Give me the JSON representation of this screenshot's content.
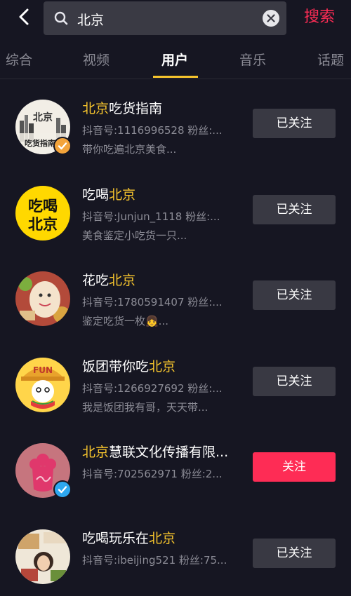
{
  "header": {
    "search_value": "北京",
    "search_button_label": "搜索"
  },
  "tabs": [
    {
      "label": "综合",
      "active": false
    },
    {
      "label": "视频",
      "active": false
    },
    {
      "label": "用户",
      "active": true
    },
    {
      "label": "音乐",
      "active": false
    },
    {
      "label": "话题",
      "active": false
    }
  ],
  "colors": {
    "accent": "#f6c42d",
    "brand_red": "#fe2c55",
    "background": "#161622"
  },
  "users": [
    {
      "name_highlight": "北京",
      "name_rest": "吃货指南",
      "name_highlight_first": true,
      "id_line": "抖音号:1116996528 粉丝:...",
      "desc": "带你吃遍北京美食...",
      "button_label": "已关注",
      "button_style": "followed",
      "verified": "orange",
      "avatar_text_top": "北京",
      "avatar_text_bottom": "吃货指南"
    },
    {
      "name_highlight": "北京",
      "name_rest": "吃喝",
      "name_highlight_first": false,
      "id_line": "抖音号:Junjun_1118 粉丝:...",
      "desc": "美食鉴定小吃货一只...",
      "button_label": "已关注",
      "button_style": "followed",
      "verified": "none",
      "avatar_text_top": "吃喝",
      "avatar_text_bottom": "北京"
    },
    {
      "name_highlight": "北京",
      "name_rest": "花吃",
      "name_highlight_first": false,
      "id_line": "抖音号:1780591407 粉丝:...",
      "desc": "鉴定吃货一枚👧...",
      "button_label": "已关注",
      "button_style": "followed",
      "verified": "none"
    },
    {
      "name_highlight": "北京",
      "name_rest": "饭团带你吃",
      "name_highlight_first": false,
      "id_line": "抖音号:1266927692 粉丝:...",
      "desc": "我是饭团我有哥，天天带...",
      "button_label": "已关注",
      "button_style": "followed",
      "verified": "none",
      "avatar_text_top": "FUN"
    },
    {
      "name_highlight": "北京",
      "name_rest": "慧联文化传播有限...",
      "name_highlight_first": true,
      "id_line": "抖音号:702562971 粉丝:2...",
      "desc": "",
      "button_label": "关注",
      "button_style": "primary",
      "verified": "blue"
    },
    {
      "name_highlight": "北京",
      "name_rest": "吃喝玩乐在",
      "name_highlight_first": false,
      "id_line": "抖音号:ibeijing521 粉丝:75...",
      "desc": "",
      "button_label": "已关注",
      "button_style": "followed",
      "verified": "none"
    }
  ]
}
